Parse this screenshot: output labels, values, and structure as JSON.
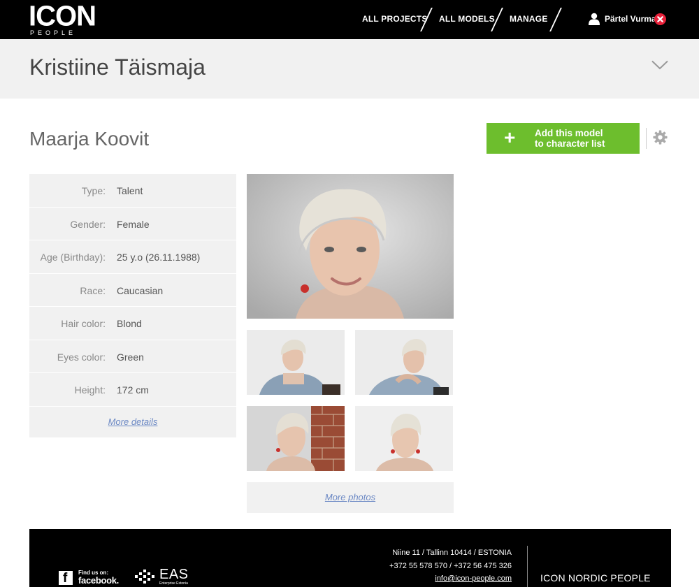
{
  "header": {
    "logo_main": "ICON",
    "logo_sub": "PEOPLE",
    "nav": [
      {
        "label": "ALL PROJECTS"
      },
      {
        "label": "ALL MODELS"
      },
      {
        "label": "MANAGE"
      }
    ],
    "user_name": "Pärtel Vurma"
  },
  "project": {
    "title": "Kristiine Täismaja"
  },
  "model": {
    "name": "Maarja Koovit",
    "add_button_line1": "Add this model",
    "add_button_line2": "to character list",
    "details": [
      {
        "label": "Type:",
        "value": "Talent"
      },
      {
        "label": "Gender:",
        "value": "Female"
      },
      {
        "label": "Age (Birthday):",
        "value": "25 y.o (26.11.1988)"
      },
      {
        "label": "Race:",
        "value": "Caucasian"
      },
      {
        "label": "Hair color:",
        "value": "Blond"
      },
      {
        "label": "Eyes color:",
        "value": "Green"
      },
      {
        "label": "Height:",
        "value": "172 cm"
      }
    ],
    "more_details": "More details",
    "more_photos": "More photos"
  },
  "footer": {
    "facebook_small": "Find us on:",
    "facebook_big": "facebook.",
    "eas": "EAS",
    "eas_sub": "Enterprise Estonia",
    "address_line1": "Niine 11 / Tallinn 10414 / ESTONIA",
    "address_line2": "+372 55 578 570 / +372 56 475 326",
    "email": "info@icon-people.com",
    "company": "ICON NORDIC PEOPLE"
  },
  "colors": {
    "topbar": "#000000",
    "accent_green": "#6dbe2d",
    "logout_red": "#e8213a",
    "panel_grey": "#f1f1f1",
    "link_blue": "#6b88c4"
  }
}
